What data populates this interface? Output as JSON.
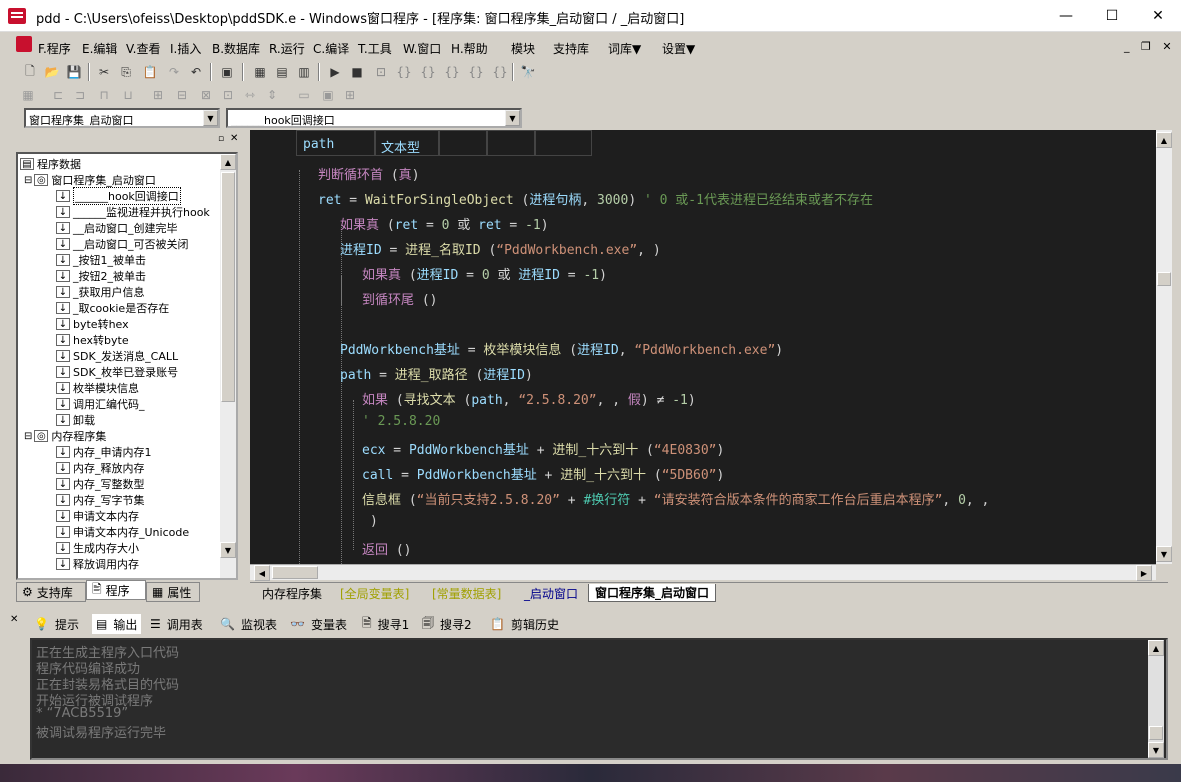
{
  "window": {
    "title": "pdd - C:\\Users\\ofeiss\\Desktop\\pddSDK.e - Windows窗口程序 - [程序集: 窗口程序集_启动窗口 / _启动窗口]",
    "minimize": "—",
    "maximize": "☐",
    "close": "✕"
  },
  "menu": [
    "F.程序",
    "E.编辑",
    "V.查看",
    "I.插入",
    "B.数据库",
    "R.运行",
    "C.编译",
    "T.工具",
    "W.窗口",
    "H.帮助",
    "模块",
    "支持库",
    "词库▼",
    "设置▼"
  ],
  "combos": {
    "left": "窗口程序集_启动窗口",
    "right": "______hook回调接口"
  },
  "tree": {
    "root": "程序数据",
    "items": [
      {
        "label": "窗口程序集_启动窗口",
        "level": 1,
        "expanded": true
      },
      {
        "label": "______hook回调接口",
        "level": 2,
        "selected": true
      },
      {
        "label": "______监视进程并执行hook",
        "level": 2
      },
      {
        "label": "__启动窗口_创建完毕",
        "level": 2
      },
      {
        "label": "__启动窗口_可否被关闭",
        "level": 2
      },
      {
        "label": "_按钮1_被单击",
        "level": 2
      },
      {
        "label": "_按钮2_被单击",
        "level": 2
      },
      {
        "label": "_获取用户信息",
        "level": 2
      },
      {
        "label": "_取cookie是否存在",
        "level": 2
      },
      {
        "label": "byte转hex",
        "level": 2
      },
      {
        "label": "hex转byte",
        "level": 2
      },
      {
        "label": "SDK_发送消息_CALL",
        "level": 2
      },
      {
        "label": "SDK_枚举已登录账号",
        "level": 2
      },
      {
        "label": "枚举模块信息",
        "level": 2
      },
      {
        "label": "调用汇编代码_",
        "level": 2
      },
      {
        "label": "卸载",
        "level": 2
      },
      {
        "label": "内存程序集",
        "level": 1,
        "expanded": true
      },
      {
        "label": "内存_申请内存1",
        "level": 2
      },
      {
        "label": "内存_释放内存",
        "level": 2
      },
      {
        "label": "内存_写整数型",
        "level": 2
      },
      {
        "label": "内存_写字节集",
        "level": 2
      },
      {
        "label": "申请文本内存",
        "level": 2
      },
      {
        "label": "申请文本内存_Unicode",
        "level": 2
      },
      {
        "label": "生成内存大小",
        "level": 2
      },
      {
        "label": "释放调用内存",
        "level": 2
      }
    ]
  },
  "left_tabs": [
    "支持库",
    "程序",
    "属性"
  ],
  "editor": {
    "header": [
      "path",
      "文本型"
    ],
    "lines": [
      [
        [
          "kw",
          "判断循环首"
        ],
        [
          "id",
          " ("
        ],
        [
          "kw",
          "真"
        ],
        [
          "id",
          ")"
        ]
      ],
      [
        [
          "var",
          "ret"
        ],
        [
          "id",
          " = "
        ],
        [
          "fn",
          " WaitForSingleObject"
        ],
        [
          "id",
          " ("
        ],
        [
          "var",
          "进程句柄"
        ],
        [
          "id",
          ", "
        ],
        [
          "num",
          "3000"
        ],
        [
          "id",
          ")  "
        ],
        [
          "cm",
          "' 0 或-1代表进程已经结束或者不存在"
        ]
      ],
      [
        [
          "kw",
          "如果真"
        ],
        [
          "id",
          " ("
        ],
        [
          "var",
          "ret"
        ],
        [
          "id",
          " = "
        ],
        [
          "num",
          " 0"
        ],
        [
          "id",
          " 或 "
        ],
        [
          "var",
          "ret"
        ],
        [
          "id",
          " = "
        ],
        [
          "num",
          " -1"
        ],
        [
          "id",
          ")"
        ]
      ],
      [
        [
          "var",
          "进程ID"
        ],
        [
          "id",
          " = "
        ],
        [
          "fn",
          " 进程_名取ID"
        ],
        [
          "id",
          " ("
        ],
        [
          "str",
          "“PddWorkbench.exe”"
        ],
        [
          "id",
          ", )"
        ]
      ],
      [
        [
          "kw",
          "如果真"
        ],
        [
          "id",
          " ("
        ],
        [
          "var",
          "进程ID"
        ],
        [
          "id",
          " = "
        ],
        [
          "num",
          " 0"
        ],
        [
          "id",
          " 或 "
        ],
        [
          "var",
          "进程ID"
        ],
        [
          "id",
          " = "
        ],
        [
          "num",
          " -1"
        ],
        [
          "id",
          ")"
        ]
      ],
      [
        [
          "kw",
          "到循环尾"
        ],
        [
          "id",
          " ()"
        ]
      ],
      [],
      [
        [
          "var",
          "PddWorkbench基址"
        ],
        [
          "id",
          " = "
        ],
        [
          "fn",
          " 枚举模块信息"
        ],
        [
          "id",
          " ("
        ],
        [
          "var",
          "进程ID"
        ],
        [
          "id",
          ", "
        ],
        [
          "str",
          "“PddWorkbench.exe”"
        ],
        [
          "id",
          ")"
        ]
      ],
      [
        [
          "var",
          "path"
        ],
        [
          "id",
          " = "
        ],
        [
          "fn",
          " 进程_取路径"
        ],
        [
          "id",
          " ("
        ],
        [
          "var",
          "进程ID"
        ],
        [
          "id",
          ")"
        ]
      ],
      [
        [
          "kw",
          "如果"
        ],
        [
          "id",
          " ("
        ],
        [
          "fn",
          "寻找文本"
        ],
        [
          "id",
          " ("
        ],
        [
          "var",
          "path"
        ],
        [
          "id",
          ", "
        ],
        [
          "str",
          " “2.5.8.20”"
        ],
        [
          "id",
          ", , "
        ],
        [
          "kw",
          "假"
        ],
        [
          "id",
          ") ≠ "
        ],
        [
          "num",
          " -1"
        ],
        [
          "id",
          ")"
        ]
      ],
      [
        [
          "cm",
          "' 2.5.8.20"
        ]
      ],
      [
        [
          "var",
          "ecx"
        ],
        [
          "id",
          " = "
        ],
        [
          "var",
          " PddWorkbench基址"
        ],
        [
          "id",
          " + "
        ],
        [
          "fn",
          " 进制_十六到十"
        ],
        [
          "id",
          " ("
        ],
        [
          "str",
          "“4E0830”"
        ],
        [
          "id",
          ")"
        ]
      ],
      [
        [
          "var",
          "call"
        ],
        [
          "id",
          " = "
        ],
        [
          "var",
          " PddWorkbench基址"
        ],
        [
          "id",
          " + "
        ],
        [
          "fn",
          " 进制_十六到十"
        ],
        [
          "id",
          " ("
        ],
        [
          "str",
          "“5DB60”"
        ],
        [
          "id",
          ")"
        ]
      ],
      [
        [
          "fn",
          "信息框"
        ],
        [
          "id",
          " ("
        ],
        [
          "str",
          "“当前只支持2.5.8.20”"
        ],
        [
          "id",
          "  + "
        ],
        [
          "cn",
          " #换行符"
        ],
        [
          "id",
          "  + "
        ],
        [
          "str",
          " “请安装符合版本条件的商家工作台后重启本程序”"
        ],
        [
          "id",
          ", "
        ],
        [
          "num",
          "0"
        ],
        [
          "id",
          ", , "
        ]
      ],
      [
        [
          "id",
          ")"
        ]
      ],
      [
        [
          "kw",
          "返回"
        ],
        [
          "id",
          " ()"
        ]
      ]
    ]
  },
  "editor_tabs": [
    "内存程序集",
    "[全局变量表]",
    "[常量数据表]",
    "_启动窗口",
    "窗口程序集_启动窗口"
  ],
  "output_tabs": [
    "提示",
    "输出",
    "调用表",
    "监视表",
    "变量表",
    "搜寻1",
    "搜寻2",
    "剪辑历史"
  ],
  "output_lines": [
    "正在生成主程序入口代码",
    "程序代码编译成功",
    "正在封装易格式目的代码",
    "开始运行被调试程序",
    "* “7ACB5519”",
    "被调试易程序运行完毕"
  ]
}
